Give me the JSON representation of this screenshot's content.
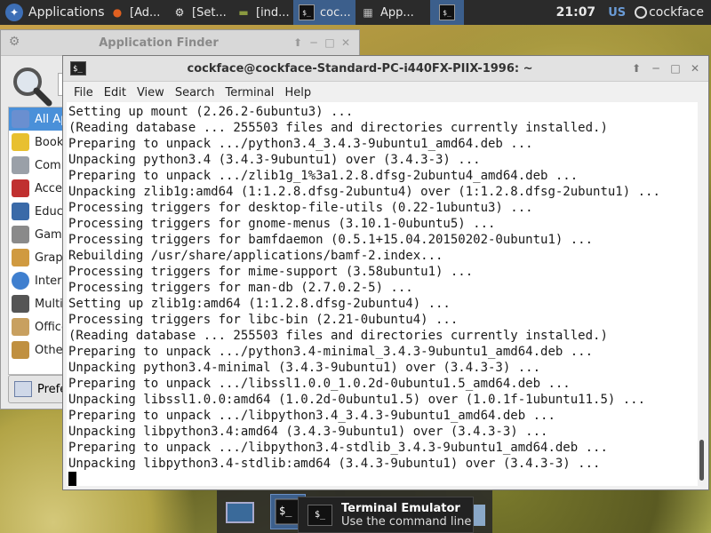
{
  "top_panel": {
    "applications": "Applications",
    "tasks": [
      {
        "label": "[Ad...",
        "icon": "firefox-icon"
      },
      {
        "label": "[Set...",
        "icon": "settings-icon"
      },
      {
        "label": "[ind...",
        "icon": "package-icon"
      },
      {
        "label": "coc...",
        "icon": "terminal-icon"
      },
      {
        "label": "App...",
        "icon": "app-finder-icon"
      }
    ],
    "clock": "21:07",
    "keyboard_layout": "US",
    "user": "cockface"
  },
  "app_finder": {
    "title": "Application Finder",
    "search_value": "",
    "categories": [
      {
        "label": "All Applications",
        "color": "#6a8fd0"
      },
      {
        "label": "Bookmarks",
        "color": "#e8c030"
      },
      {
        "label": "Commands",
        "color": "#9aa0a8"
      },
      {
        "label": "Accessories",
        "color": "#c03030"
      },
      {
        "label": "Education",
        "color": "#3a6aa8"
      },
      {
        "label": "Games",
        "color": "#8a8a8a"
      },
      {
        "label": "Graphics",
        "color": "#d09a40"
      },
      {
        "label": "Internet",
        "color": "#3f7fcf"
      },
      {
        "label": "Multimedia",
        "color": "#555555"
      },
      {
        "label": "Office",
        "color": "#c8a060"
      },
      {
        "label": "Other",
        "color": "#c09040"
      }
    ],
    "preferences": "Preferences"
  },
  "terminal": {
    "title": "cockface@cockface-Standard-PC-i440FX-PIIX-1996: ~",
    "menu": [
      "File",
      "Edit",
      "View",
      "Search",
      "Terminal",
      "Help"
    ],
    "lines": [
      "Setting up mount (2.26.2-6ubuntu3) ...",
      "(Reading database ... 255503 files and directories currently installed.)",
      "Preparing to unpack .../python3.4_3.4.3-9ubuntu1_amd64.deb ...",
      "Unpacking python3.4 (3.4.3-9ubuntu1) over (3.4.3-3) ...",
      "Preparing to unpack .../zlib1g_1%3a1.2.8.dfsg-2ubuntu4_amd64.deb ...",
      "Unpacking zlib1g:amd64 (1:1.2.8.dfsg-2ubuntu4) over (1:1.2.8.dfsg-2ubuntu1) ...",
      "Processing triggers for desktop-file-utils (0.22-1ubuntu3) ...",
      "Processing triggers for gnome-menus (3.10.1-0ubuntu5) ...",
      "Processing triggers for bamfdaemon (0.5.1+15.04.20150202-0ubuntu1) ...",
      "Rebuilding /usr/share/applications/bamf-2.index...",
      "Processing triggers for mime-support (3.58ubuntu1) ...",
      "Processing triggers for man-db (2.7.0.2-5) ...",
      "Setting up zlib1g:amd64 (1:1.2.8.dfsg-2ubuntu4) ...",
      "Processing triggers for libc-bin (2.21-0ubuntu4) ...",
      "(Reading database ... 255503 files and directories currently installed.)",
      "Preparing to unpack .../python3.4-minimal_3.4.3-9ubuntu1_amd64.deb ...",
      "Unpacking python3.4-minimal (3.4.3-9ubuntu1) over (3.4.3-3) ...",
      "Preparing to unpack .../libssl1.0.0_1.0.2d-0ubuntu1.5_amd64.deb ...",
      "Unpacking libssl1.0.0:amd64 (1.0.2d-0ubuntu1.5) over (1.0.1f-1ubuntu11.5) ...",
      "Preparing to unpack .../libpython3.4_3.4.3-9ubuntu1_amd64.deb ...",
      "Unpacking libpython3.4:amd64 (3.4.3-9ubuntu1) over (3.4.3-3) ...",
      "Preparing to unpack .../libpython3.4-stdlib_3.4.3-9ubuntu1_amd64.deb ...",
      "Unpacking libpython3.4-stdlib:amd64 (3.4.3-9ubuntu1) over (3.4.3-3) ..."
    ]
  },
  "dock": {
    "tooltip_title": "Terminal Emulator",
    "tooltip_subtitle": "Use the command line"
  }
}
